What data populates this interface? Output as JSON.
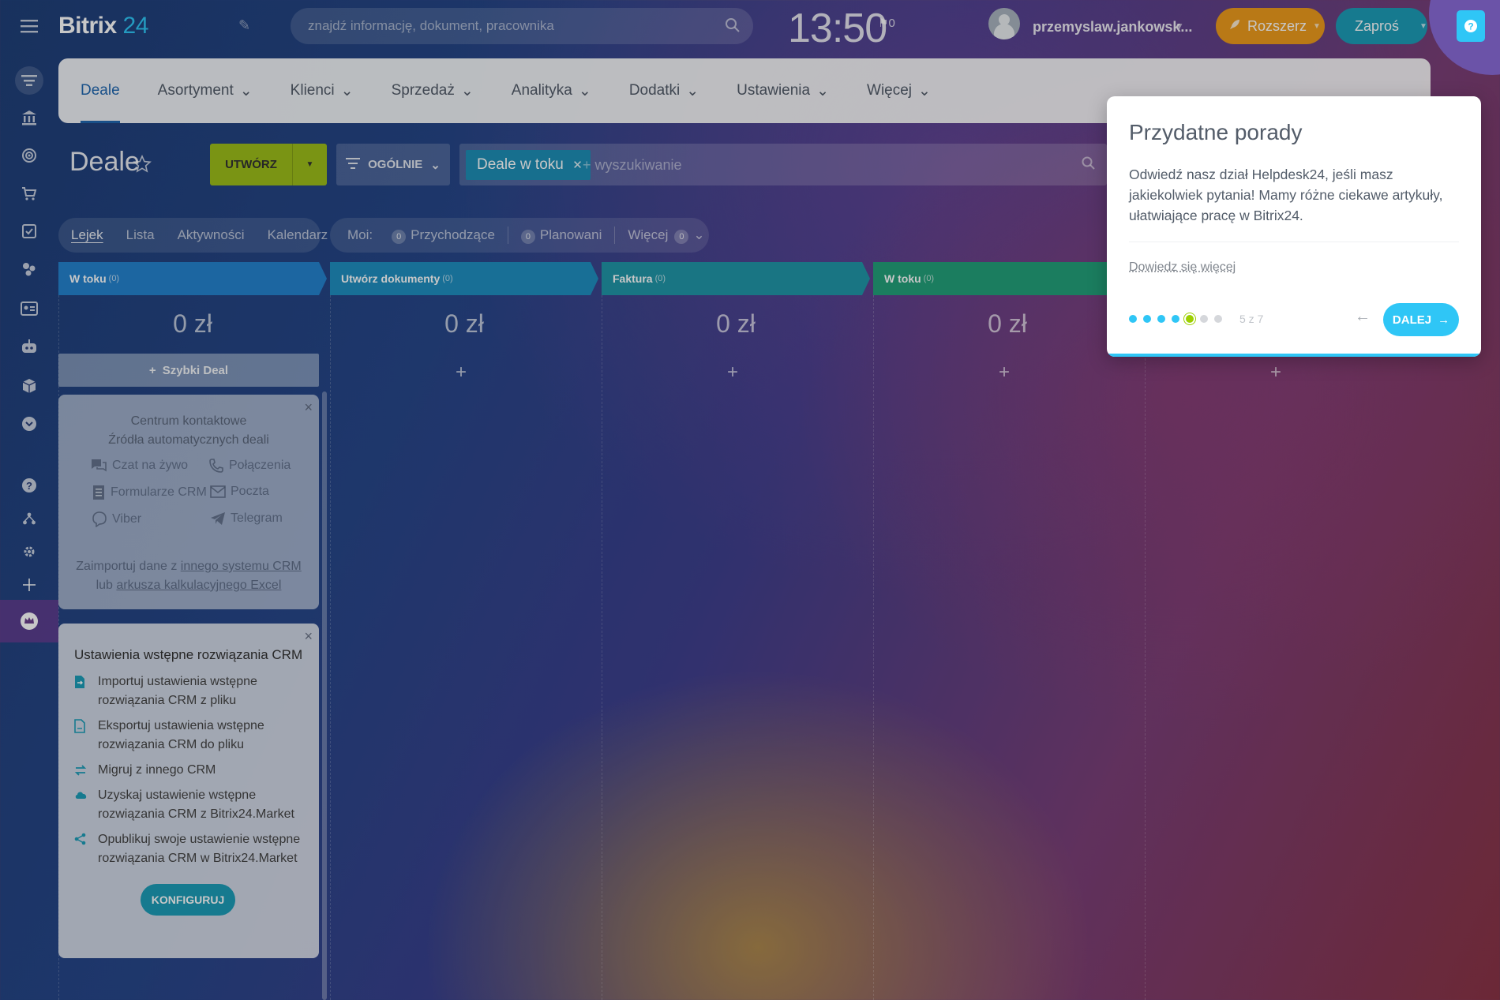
{
  "header": {
    "logo_brand": "Bitrix",
    "logo_number": "24",
    "search_placeholder": "znajdź informację, dokument, pracownika",
    "clock": "13:50",
    "flag_count": "0",
    "username": "przemyslaw.jankowsk...",
    "rozszerz_label": "Rozszerz",
    "zapros_label": "Zaproś"
  },
  "nav": {
    "items": [
      {
        "label": "Deale"
      },
      {
        "label": "Asortyment"
      },
      {
        "label": "Klienci"
      },
      {
        "label": "Sprzedaż"
      },
      {
        "label": "Analityka"
      },
      {
        "label": "Dodatki"
      },
      {
        "label": "Ustawienia"
      },
      {
        "label": "Więcej"
      }
    ]
  },
  "toolbar": {
    "page_title": "Deale",
    "create_label": "UTWÓRZ",
    "general_label": "OGÓLNIE",
    "filter_chip": "Deale w toku",
    "filter_placeholder": "+ wyszukiwanie"
  },
  "views": {
    "tabs": [
      "Lejek",
      "Lista",
      "Aktywności",
      "Kalendarz"
    ],
    "mine_label": "Moi:",
    "incoming_count": "0",
    "incoming_label": "Przychodzące",
    "planned_count": "0",
    "planned_label": "Planowani",
    "more_label": "Więcej",
    "more_count": "0"
  },
  "columns": [
    {
      "name": "W toku",
      "count": "(0)",
      "sum": "0 zł",
      "color": "#2483cf"
    },
    {
      "name": "Utwórz dokumenty",
      "count": "(0)",
      "sum": "0 zł",
      "color": "#1f8fc0"
    },
    {
      "name": "Faktura",
      "count": "(0)",
      "sum": "0 zł",
      "color": "#2196a8"
    },
    {
      "name": "W toku",
      "count": "(0)",
      "sum": "0 zł",
      "color": "#23a07a"
    }
  ],
  "quick_deal_label": "Szybki Deal",
  "contact_center": {
    "title_line1": "Centrum kontaktowe",
    "title_line2": "Źródła automatycznych deali",
    "channels": [
      "Czat na żywo",
      "Połączenia",
      "Formularze CRM",
      "Poczta",
      "Viber",
      "Telegram"
    ],
    "import_text_1": "Zaimportuj dane z ",
    "import_link_1": "innego systemu CRM",
    "import_text_2": " lub ",
    "import_link_2": "arkusza kalkulacyjnego Excel"
  },
  "setup": {
    "title": "Ustawienia wstępne rozwiązania CRM",
    "items": [
      "Importuj ustawienia wstępne rozwiązania CRM z pliku",
      "Eksportuj ustawienia wstępne rozwiązania CRM do pliku",
      "Migruj z innego CRM",
      "Uzyskaj ustawienie wstępne rozwiązania CRM z Bitrix24.Market",
      "Opublikuj swoje ustawienie wstępne rozwiązania CRM w Bitrix24.Market"
    ],
    "button_label": "KONFIGURUJ"
  },
  "tip": {
    "title": "Przydatne porady",
    "body": "Odwiedź nasz dział Helpdesk24, jeśli masz jakiekolwiek pytania! Mamy różne ciekawe artykuły, ułatwiające pracę w Bitrix24.",
    "link": "Dowiedz się więcej",
    "step_text": "5 z 7",
    "current_step": 5,
    "total_steps": 7,
    "next_label": "DALEJ"
  },
  "colors": {
    "accent_blue": "#2fc6f6",
    "create_green": "#9dbe1a",
    "rozszerz_orange": "#ee9b1d",
    "zapros_teal": "#1d9db8"
  }
}
